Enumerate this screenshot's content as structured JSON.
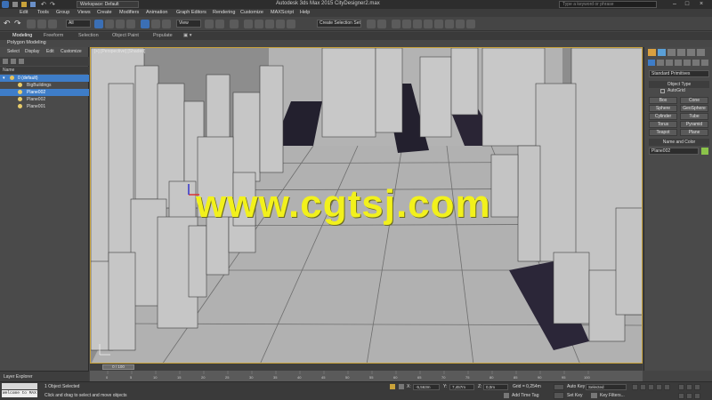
{
  "title_bar": {
    "workspace": "Workspace: Default",
    "title": "Autodesk 3ds Max 2015    CityDesigner2.max",
    "search_placeholder": "Type a keyword or phrase"
  },
  "menu": [
    "Edit",
    "Tools",
    "Group",
    "Views",
    "Create",
    "Modifiers",
    "Animation",
    "Graph Editors",
    "Rendering",
    "Customize",
    "MAXScript",
    "Help"
  ],
  "toolbar": {
    "selection_filter": "All",
    "ref_coord": "View",
    "named_selection": "Create Selection Set"
  },
  "ribbon": {
    "tabs": [
      "Modeling",
      "Freeform",
      "Selection",
      "Object Paint",
      "Populate"
    ],
    "active_tab": "Modeling",
    "sub_label": "Polygon Modeling"
  },
  "scene_explorer": {
    "menu": [
      "Select",
      "Display",
      "Edit",
      "Customize"
    ],
    "header": "Name",
    "rows": [
      {
        "label": "0 (default)",
        "selected": true
      },
      {
        "label": "BigBuildings",
        "selected": false
      },
      {
        "label": "Plane002",
        "selected": true
      },
      {
        "label": "Plane002",
        "selected": false
      },
      {
        "label": "Plane001",
        "selected": false
      }
    ]
  },
  "viewport": {
    "label": "[+] [Perspective] [Shaded]",
    "watermark": "www.cgtsj.com"
  },
  "command_panel": {
    "category": "Standard Primitives",
    "object_type_title": "Object Type",
    "autogrid": "AutoGrid",
    "primitives": [
      "Box",
      "Cone",
      "Sphere",
      "GeoSphere",
      "Cylinder",
      "Tube",
      "Torus",
      "Pyramid",
      "Teapot",
      "Plane"
    ],
    "name_color_title": "Name and Color",
    "object_name": "Plane002",
    "object_color": "#8bc34a"
  },
  "timeline": {
    "slider": "0 / 100",
    "ticks": [
      "0",
      "5",
      "10",
      "15",
      "20",
      "25",
      "30",
      "35",
      "40",
      "45",
      "50",
      "55",
      "60",
      "65",
      "70",
      "75",
      "80",
      "85",
      "90",
      "95",
      "100"
    ]
  },
  "layer_explorer": "Layer Explorer",
  "status": {
    "maxscript": "Welcome to MAX",
    "selected": "1 Object Selected",
    "prompt": "Click and drag to select and move objects",
    "x_label": "X:",
    "x_value": "-5,563m",
    "y_label": "Y:",
    "y_value": "7,457m",
    "z_label": "Z:",
    "z_value": "0,0m",
    "grid": "Grid = 0,254m",
    "add_time_tag": "Add Time Tag",
    "auto_key": "Auto Key",
    "set_key": "Set Key",
    "key_mode": "Selected",
    "key_filters": "Key Filters..."
  },
  "colors": {
    "selection_blue": "#3e7dc8",
    "watermark_yellow": "#f2f11c",
    "viewport_bg": "#8f8f8f"
  }
}
